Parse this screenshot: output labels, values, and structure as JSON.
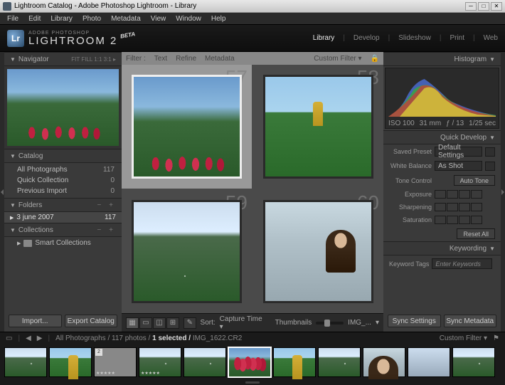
{
  "window": {
    "title": "Lightroom Catalog - Adobe Photoshop Lightroom - Library"
  },
  "menu": [
    "File",
    "Edit",
    "Library",
    "Photo",
    "Metadata",
    "View",
    "Window",
    "Help"
  ],
  "brand": {
    "small": "ADOBE PHOTOSHOP",
    "big": "LIGHTROOM 2",
    "beta": "BETA"
  },
  "modules": [
    "Library",
    "Develop",
    "Slideshow",
    "Print",
    "Web"
  ],
  "active_module": "Library",
  "navigator": {
    "title": "Navigator",
    "opts": "FIT   FILL   1:1   3:1 ▸"
  },
  "catalog": {
    "title": "Catalog",
    "items": [
      {
        "label": "All Photographs",
        "count": "117"
      },
      {
        "label": "Quick Collection",
        "count": "0"
      },
      {
        "label": "Previous Import",
        "count": "0"
      }
    ]
  },
  "folders": {
    "title": "Folders",
    "item": {
      "label": "3 june 2007",
      "count": "117"
    }
  },
  "collections": {
    "title": "Collections",
    "item": "Smart Collections"
  },
  "left_buttons": {
    "import": "Import...",
    "export": "Export Catalog"
  },
  "filterbar": {
    "label": "Filter :",
    "opts": [
      "Text",
      "Refine",
      "Metadata"
    ],
    "custom": "Custom Filter"
  },
  "grid_nums": [
    "57",
    "58",
    "59",
    "60"
  ],
  "toolbar": {
    "sort": "Sort:",
    "sortval": "Capture Time",
    "thumbs": "Thumbnails",
    "img": "IMG_..."
  },
  "histogram": {
    "title": "Histogram",
    "info": [
      "ISO 100",
      "31 mm",
      "ƒ / 13",
      "1/25 sec"
    ]
  },
  "quickdev": {
    "title": "Quick Develop",
    "preset": {
      "lbl": "Saved Preset",
      "val": "Default Settings"
    },
    "wb": {
      "lbl": "White Balance",
      "val": "As Shot"
    },
    "tone": {
      "lbl": "Tone Control",
      "btn": "Auto Tone"
    },
    "sliders": [
      "Exposure",
      "Sharpening",
      "Saturation"
    ],
    "reset": "Reset All"
  },
  "keywording": {
    "title": "Keywording",
    "lbl": "Keyword Tags",
    "placeholder": "Enter Keywords"
  },
  "sync": {
    "settings": "Sync Settings",
    "meta": "Sync Metadata"
  },
  "status": {
    "path": "All Photographs / 117 photos /",
    "sel": "1 selected /",
    "file": "IMG_1622.CR2",
    "custom": "Custom Filter"
  }
}
